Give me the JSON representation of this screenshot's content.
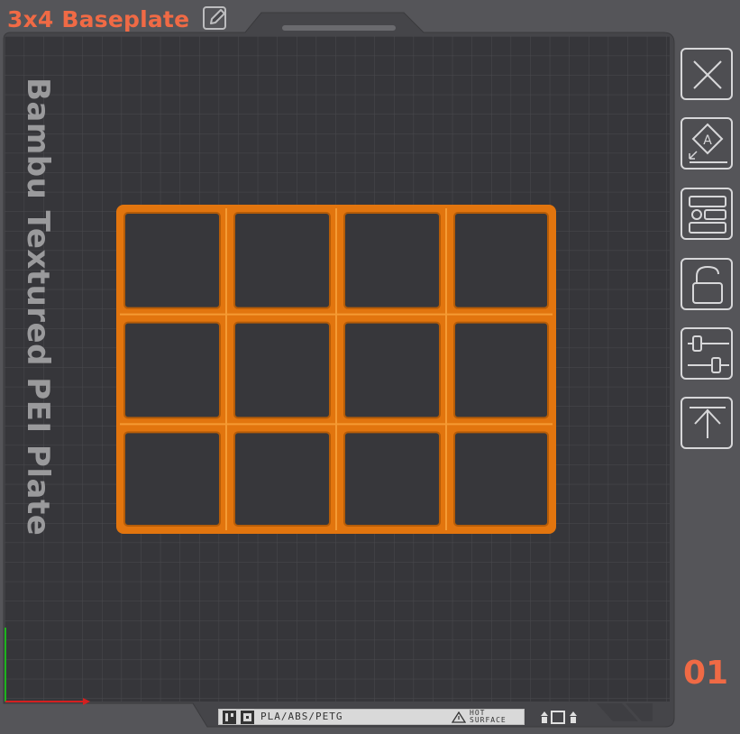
{
  "plate": {
    "title": "3x4 Baseplate",
    "bed_label": "Bambu Textured PEI Plate",
    "plate_number": "01",
    "material_label": "PLA/ABS/PETG",
    "hot_surface_line1": "HOT",
    "hot_surface_line2": "SURFACE"
  },
  "toolbar": {
    "items": [
      {
        "name": "delete-plate",
        "icon": "close-icon"
      },
      {
        "name": "auto-orient",
        "icon": "auto-orient-icon"
      },
      {
        "name": "arrange",
        "icon": "arrange-icon"
      },
      {
        "name": "lock-plate",
        "icon": "lock-icon"
      },
      {
        "name": "plate-settings",
        "icon": "sliders-icon"
      },
      {
        "name": "move-to-top",
        "icon": "move-top-icon"
      }
    ]
  },
  "model": {
    "columns": 4,
    "rows": 3,
    "color": "#e2750e"
  },
  "colors": {
    "accent": "#f06a45",
    "bed": "#37373b",
    "grid": "#47474b",
    "frame": "#4b4b4f"
  }
}
